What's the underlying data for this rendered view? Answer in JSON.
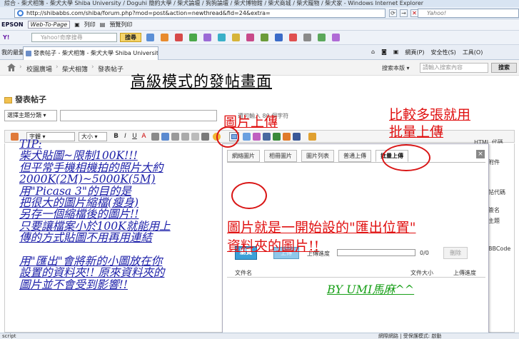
{
  "browser": {
    "window_title": "綜合 - 柴犬相簿 - 柴犬大學 Shiba University / Doguhi 簡約大學 / 柴犬論壇 / 狗狗論壇 / 柴犬博物館 / 柴犬商城 / 柴犬寵物 / 柴犬家 - Windows Internet Explorer",
    "address_url": "http://shibabbs.com/shiba/forum.php?mod=post&action=newthread&fid=24&extra=",
    "yahoo_placeholder": "Yahoo!",
    "toolbar1_brand": "EPSON",
    "toolbar1_webtopage": "Web-To-Page",
    "toolbar1_print": "列印",
    "toolbar1_preview": "預覽列印",
    "yahoo_search_placeholder": "Yahoo!奇摩搜尋",
    "yahoo_search_button": "搜尋",
    "favorites_label": "我的最愛",
    "tab_title": "發表帖子 - 柴犬相簿 - 柴犬大學 Shiba University...",
    "right_menu": [
      "網頁(P)",
      "安全性(S)",
      "工具(O)"
    ]
  },
  "site": {
    "breadcrumb": [
      "校園廣場",
      "柴犬相簿",
      "發表帖子"
    ],
    "site_search_label": "搜索本版",
    "search_placeholder": "請輸入搜索內容",
    "search_button": "搜索"
  },
  "headline": "高級模式的發帖畫面",
  "form": {
    "post_title": "發表帖子",
    "topic_select": "選擇主題分類",
    "char_limit": "還可輸入 80 個字符"
  },
  "editor": {
    "font_select": "字體",
    "size_select": "大小",
    "bold": "B",
    "italic": "I",
    "underline": "U",
    "color": "A",
    "html_code": "HTML 代碼"
  },
  "tip_lines": [
    "TIP:",
    "柴犬貼圖~限制100K!!!",
    "但平常手機相機拍的照片大約",
    "2000K(2M)~5000K(5M)",
    "用\"Picasa 3\"的目的是",
    "把很大的圖片縮檔(瘦身)",
    "另存一個縮檔後的圖片!!",
    "只要讓檔案小於100K就能用上",
    "傳的方式貼圖不用再用連結",
    "",
    "用\"匯出\"會將新的小圖放在你",
    "設置的資料夾!! 原來資料夾的",
    "圖片並不會受到影響!!"
  ],
  "right_stubs": [
    "附件",
    "帖代碼",
    "簽名",
    "主題",
    "BBCode"
  ],
  "dialog": {
    "tabs": [
      "網絡圖片",
      "相冊圖片",
      "圖片列表",
      "普通上傳",
      "批量上傳"
    ],
    "close": "×",
    "browse_button": "瀏覽",
    "upload_button": "上傳",
    "progress_label": "上傳進度",
    "progress": 0,
    "progress_count": "0/0",
    "delete_button": "刪除",
    "file_header": [
      "文件名",
      "文件大小",
      "上傳進度"
    ]
  },
  "annotations": {
    "image_upload": "圖片上傳",
    "batch_upload_1": "比較多張就用",
    "batch_upload_2": "批量上傳",
    "export_1": "圖片就是一開始設的\"匯出位置\"",
    "export_2": "資料夾的圖片!!",
    "signature": "BY  UMI馬麻^^"
  },
  "statusbar": {
    "left": "script",
    "right": "網際網路 | 受保護模式: 啟動"
  },
  "colors": {
    "annotation_red": "#e01010",
    "tip_blue": "#1b1ea8",
    "signature_green": "#19a019",
    "browse_blue": "#3aa0d8"
  }
}
